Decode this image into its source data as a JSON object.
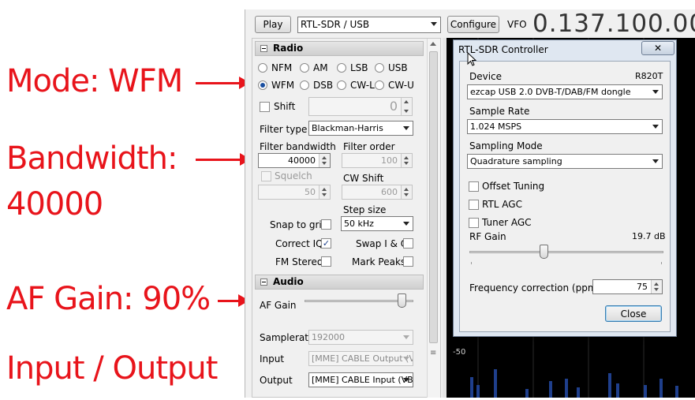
{
  "annotations": {
    "mode": "Mode: WFM",
    "bandwidth_line1": "Bandwidth:",
    "bandwidth_line2": "40000",
    "af_gain": "AF Gain: 90%",
    "io": "Input / Output"
  },
  "toolbar": {
    "play_label": "Play",
    "source": "RTL-SDR / USB",
    "configure_label": "Configure",
    "vfo_label": "VFO",
    "frequency": "0.137.100.00"
  },
  "radio": {
    "section_title": "Radio",
    "modes": [
      "NFM",
      "AM",
      "LSB",
      "USB",
      "WFM",
      "DSB",
      "CW-L",
      "CW-U"
    ],
    "selected_mode": "WFM",
    "shift_label": "Shift",
    "shift_value": "0",
    "filter_type_label": "Filter type",
    "filter_type_value": "Blackman-Harris",
    "filter_bandwidth_label": "Filter bandwidth",
    "filter_bandwidth_value": "40000",
    "filter_order_label": "Filter order",
    "filter_order_value": "100",
    "squelch_label": "Squelch",
    "squelch_value": "50",
    "cw_shift_label": "CW Shift",
    "cw_shift_value": "600",
    "step_size_label": "Step size",
    "step_size_value": "50 kHz",
    "snap_label": "Snap to grid",
    "snap_checked": false,
    "correct_iq_label": "Correct IQ",
    "correct_iq_checked": true,
    "swap_iq_label": "Swap I & Q",
    "swap_iq_checked": false,
    "fm_stereo_label": "FM Stereo",
    "fm_stereo_checked": false,
    "mark_peaks_label": "Mark Peaks",
    "mark_peaks_checked": false
  },
  "audio": {
    "section_title": "Audio",
    "af_gain_label": "AF Gain",
    "af_gain_percent": 90,
    "samplerate_label": "Samplerate",
    "samplerate_value": "192000",
    "input_label": "Input",
    "input_value": "[MME] CABLE Output (V",
    "output_label": "Output",
    "output_value": "[MME] CABLE Input (VB"
  },
  "dialog": {
    "title": "RTL-SDR Controller",
    "close_x": "✕",
    "device_label": "Device",
    "device_tuner": "R820T",
    "device_value": "ezcap USB 2.0 DVB-T/DAB/FM dongle",
    "sample_rate_label": "Sample Rate",
    "sample_rate_value": "1.024 MSPS",
    "sampling_mode_label": "Sampling Mode",
    "sampling_mode_value": "Quadrature sampling",
    "offset_tuning_label": "Offset Tuning",
    "rtl_agc_label": "RTL AGC",
    "tuner_agc_label": "Tuner AGC",
    "rf_gain_label": "RF Gain",
    "rf_gain_value": "19.7 dB",
    "freq_corr_label": "Frequency correction (ppm)",
    "freq_corr_value": "75",
    "close_button": "Close"
  },
  "spectrum": {
    "db_label": "-50"
  },
  "colors": {
    "annotation": "#e8141b",
    "spectrum_bg": "#000000",
    "spectrum_signal": "#1f3f8c"
  }
}
